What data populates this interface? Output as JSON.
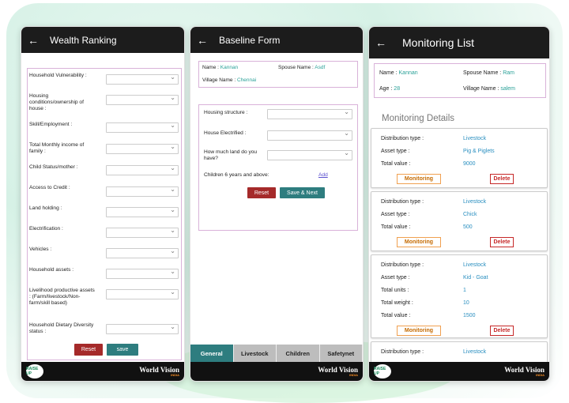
{
  "wealth": {
    "title": "Wealth Ranking",
    "fields": [
      "Household Vulnerability :",
      "Housing conditions/ownership of house :",
      "Skill/Employment :",
      "Total Monthly income of family :",
      "Child Status/mother :",
      "Access to Credit :",
      "Land holding :",
      "Electrification :",
      "Vehicles :",
      "Household assets :",
      "Livelihood productive assets : (Farm/livestock/Non-farm/skill based)",
      "Household Dietary Diversity status :"
    ],
    "reset_label": "Reset",
    "save_label": "save"
  },
  "baseline": {
    "title": "Baseline Form",
    "name_label": "Name : ",
    "name_value": "Kannan",
    "spouse_label": "Spouse Name : ",
    "spouse_value": "Asdf",
    "village_label": "Village Name : ",
    "village_value": "Chennai",
    "fields": [
      "Housing structure :",
      "House Electrified :",
      "How much land do you have?"
    ],
    "children_label": "Children 6 years and above:",
    "add_label": "Add",
    "reset_label": "Reset",
    "save_next_label": "Save & Next",
    "tabs": [
      "General",
      "Livestock",
      "Children",
      "Safetynet"
    ]
  },
  "monitoring": {
    "title": "Monitoring List",
    "name_label": "Name : ",
    "name_value": "Kannan",
    "spouse_label": "Spouse Name : ",
    "spouse_value": "Ram",
    "age_label": "Age : ",
    "age_value": "28",
    "village_label": "Village Name : ",
    "village_value": "salem",
    "section_title": "Monitoring Details",
    "monitoring_label": "Monitoring",
    "delete_label": "Delete",
    "cards": [
      {
        "rows": [
          [
            "Distribution type :",
            "Livestock"
          ],
          [
            "Asset type :",
            "Pig & Piglets"
          ],
          [
            "Total value :",
            "9000"
          ]
        ]
      },
      {
        "rows": [
          [
            "Distribution type :",
            "Livestock"
          ],
          [
            "Asset type :",
            "Chick"
          ],
          [
            "Total value :",
            "500"
          ]
        ]
      },
      {
        "rows": [
          [
            "Distribution type :",
            "Livestock"
          ],
          [
            "Asset type :",
            "Kid - Goat"
          ],
          [
            "Total units :",
            "1"
          ],
          [
            "Total weight :",
            "10"
          ],
          [
            "Total value :",
            "1500"
          ]
        ]
      },
      {
        "rows": [
          [
            "Distribution type :",
            "Livestock"
          ]
        ]
      }
    ]
  },
  "branding": {
    "org": "World Vision",
    "org_sub": "INDIA",
    "app_logo": "RAISE UP",
    "colors": {
      "teal": "#2e7d7f",
      "red": "#a52a2a",
      "accent_text": "#2aa198",
      "link_blue": "#2a8fc0"
    }
  }
}
